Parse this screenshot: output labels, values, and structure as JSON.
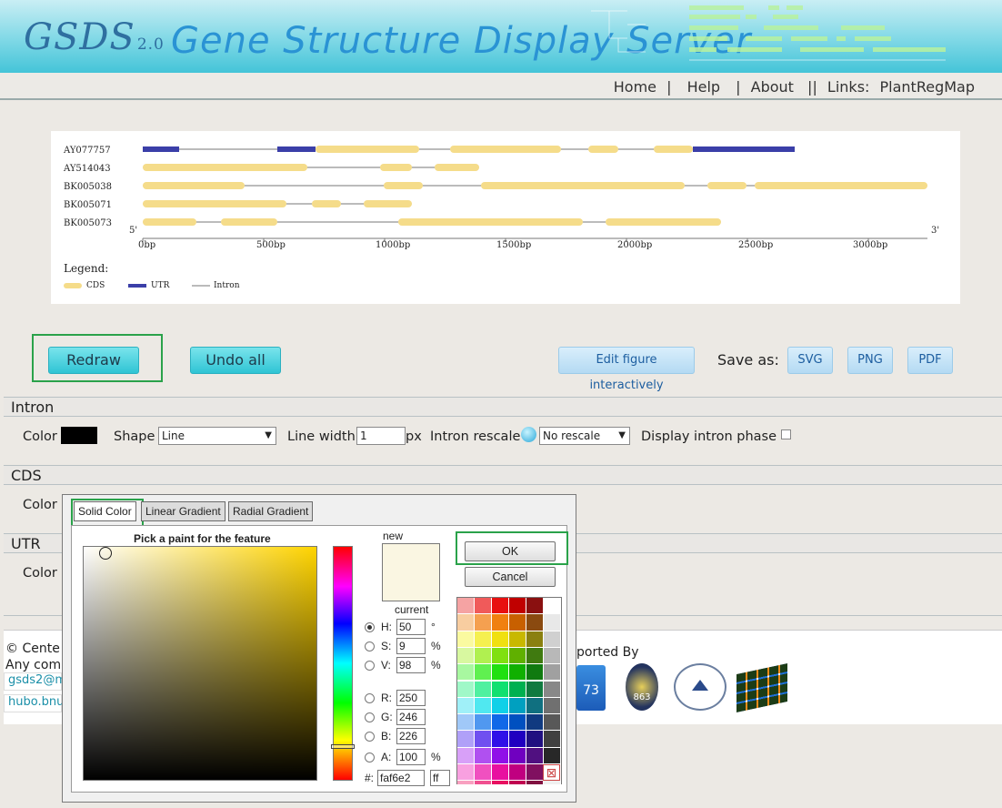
{
  "header": {
    "logo": "GSDS",
    "logo_version": "2.0",
    "title": "Gene Structure Display Server"
  },
  "nav": {
    "home": "Home",
    "help": "Help",
    "about": "About",
    "links_label": "Links:",
    "plantregmap": "PlantRegMap",
    "sep1": "|",
    "sep2": "|",
    "sep3": "||"
  },
  "figure": {
    "genes": [
      {
        "name": "AY077757"
      },
      {
        "name": "AY514043"
      },
      {
        "name": "BK005038"
      },
      {
        "name": "BK005071"
      },
      {
        "name": "BK005073"
      }
    ],
    "five_prime": "5'",
    "three_prime": "3'",
    "axis_ticks": [
      "0bp",
      "500bp",
      "1000bp",
      "1500bp",
      "2000bp",
      "2500bp",
      "3000bp"
    ],
    "legend_title": "Legend:",
    "legend": {
      "cds": "CDS",
      "utr": "UTR",
      "intron": "Intron"
    },
    "colors": {
      "cds": "#f5dc8a",
      "utr": "#3b3fa8",
      "intron": "#777777"
    }
  },
  "toolbar": {
    "redraw": "Redraw",
    "undo_all": "Undo all",
    "edit_interactively": "Edit figure interactively",
    "save_as": "Save as:",
    "svg": "SVG",
    "png": "PNG",
    "pdf": "PDF"
  },
  "intron_section": {
    "title": "Intron",
    "color_label": "Color",
    "shape_label": "Shape",
    "shape_value": "Line",
    "line_width_label": "Line width",
    "line_width_value": "1",
    "px": "px",
    "rescale_label": "Intron rescale",
    "rescale_value": "No rescale",
    "display_phase_label": "Display intron phase"
  },
  "cds_section": {
    "title": "CDS",
    "color_label": "Color"
  },
  "utr_section": {
    "title": "UTR",
    "color_label": "Color"
  },
  "footer": {
    "copyright": "© Cente",
    "any_com": "Any com",
    "email1": "gsds2@m",
    "email2": "hubo.bnu",
    "supported_by": "ported By",
    "logo_text_863": "863",
    "logo_text_973": "73"
  },
  "color_dialog": {
    "tabs": [
      "Solid Color",
      "Linear Gradient",
      "Radial Gradient"
    ],
    "prompt": "Pick a paint for the feature",
    "new_label": "new",
    "current_label": "current",
    "ok": "OK",
    "cancel": "Cancel",
    "fields": {
      "h": {
        "label": "H:",
        "value": "50",
        "unit": "°"
      },
      "s": {
        "label": "S:",
        "value": "9",
        "unit": "%"
      },
      "v": {
        "label": "V:",
        "value": "98",
        "unit": "%"
      },
      "r": {
        "label": "R:",
        "value": "250",
        "unit": ""
      },
      "g": {
        "label": "G:",
        "value": "246",
        "unit": ""
      },
      "b": {
        "label": "B:",
        "value": "226",
        "unit": ""
      },
      "a": {
        "label": "A:",
        "value": "100",
        "unit": "%"
      }
    },
    "hex_label": "#:",
    "hex_value": "faf6e2",
    "alpha_hex": "ff",
    "new_color": "#faf6e2"
  }
}
